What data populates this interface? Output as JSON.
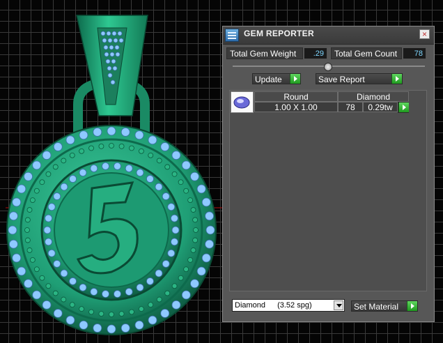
{
  "panel": {
    "title": "GEM REPORTER",
    "close_symbol": "×",
    "icon": "gem-reporter-icon"
  },
  "totals": {
    "weight_label": "Total Gem Weight",
    "weight_value": ".29",
    "count_label": "Total Gem Count",
    "count_value": "78"
  },
  "actions": {
    "update_label": "Update",
    "save_report_label": "Save Report",
    "set_material_label": "Set Material"
  },
  "gem_table": {
    "headers": [
      "Round",
      "Diamond"
    ],
    "rows": [
      {
        "size": "1.00 X 1.00",
        "count": "78",
        "weight": "0.29tw"
      }
    ]
  },
  "material": {
    "name": "Diamond",
    "spec": "(3.52 spg)"
  },
  "colors": {
    "panel_bg": "#575757",
    "metal": "#1f9e75",
    "gem": "#8ec9ff",
    "accent_green": "#2fbf2f"
  }
}
